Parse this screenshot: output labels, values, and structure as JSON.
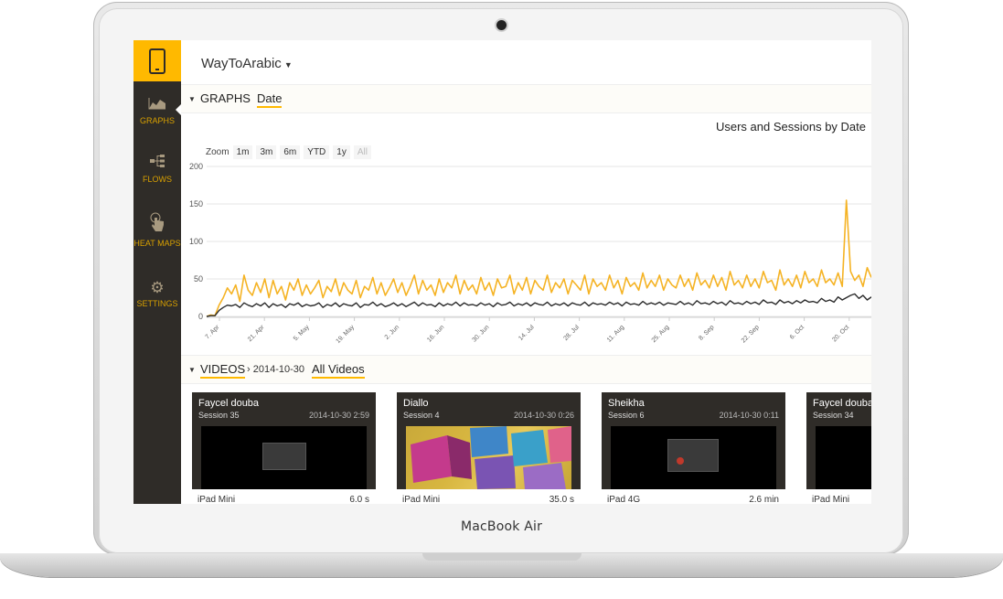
{
  "device": {
    "brand": "MacBook Air"
  },
  "app": {
    "title": "WayToArabic"
  },
  "sidebar": {
    "items": [
      {
        "label": "GRAPHS",
        "icon": "area-chart-icon"
      },
      {
        "label": "FLOWS",
        "icon": "flow-icon"
      },
      {
        "label": "HEAT MAPS",
        "icon": "touch-icon"
      },
      {
        "label": "SETTINGS",
        "icon": "gear-icon"
      }
    ]
  },
  "graphs": {
    "section_label": "GRAPHS",
    "tab_label": "Date",
    "chart_title": "Users and Sessions by Date",
    "zoom": {
      "label": "Zoom",
      "buttons": [
        "1m",
        "3m",
        "6m",
        "YTD",
        "1y",
        "All"
      ]
    }
  },
  "videos": {
    "section_label": "VIDEOS",
    "breadcrumb": "› 2014-10-30",
    "tab_label": "All Videos",
    "cards": [
      {
        "name": "Faycel douba",
        "session": "Session 35",
        "time": "2014-10-30 2:59",
        "device": "iPad Mini",
        "duration": "6.0 s"
      },
      {
        "name": "Diallo",
        "session": "Session 4",
        "time": "2014-10-30 0:26",
        "device": "iPad Mini",
        "duration": "35.0 s"
      },
      {
        "name": "Sheikha",
        "session": "Session 6",
        "time": "2014-10-30 0:11",
        "device": "iPad 4G",
        "duration": "2.6 min"
      },
      {
        "name": "Faycel douba",
        "session": "Session 34",
        "time": "",
        "device": "iPad Mini",
        "duration": ""
      }
    ]
  },
  "colors": {
    "accent": "#ffb900",
    "sidebar": "#2f2c28",
    "series_sessions": "#f5b324",
    "series_users": "#2b2b2b"
  },
  "chart_data": {
    "type": "line",
    "title": "Users and Sessions by Date",
    "xlabel": "",
    "ylabel": "",
    "ylim": [
      0,
      200
    ],
    "y_ticks": [
      0,
      50,
      100,
      150,
      200
    ],
    "x_tick_labels": [
      "7. Apr",
      "21. Apr",
      "5. May",
      "19. May",
      "2. Jun",
      "16. Jun",
      "30. Jun",
      "14. Jul",
      "28. Jul",
      "11. Aug",
      "25. Aug",
      "8. Sep",
      "22. Sep",
      "6. Oct",
      "20. Oct"
    ],
    "series": [
      {
        "values": [
          0,
          2,
          1,
          15,
          25,
          38,
          30,
          42,
          20,
          55,
          35,
          28,
          45,
          32,
          50,
          25,
          48,
          30,
          40,
          22,
          45,
          35,
          50,
          28,
          42,
          30,
          38,
          48,
          25,
          40,
          33,
          50,
          28,
          45,
          35,
          30,
          48,
          25,
          40,
          35,
          52,
          30,
          45,
          28,
          38,
          50,
          32,
          45,
          28,
          40,
          55,
          30,
          48,
          35,
          42,
          28,
          50,
          32,
          45,
          38,
          55,
          30,
          48,
          35,
          42,
          30,
          52,
          35,
          45,
          28,
          50,
          38,
          40,
          55,
          30,
          45,
          35,
          52,
          30,
          48,
          40,
          35,
          55,
          32,
          45,
          38,
          50,
          30,
          48,
          42,
          35,
          55,
          30,
          50,
          40,
          45,
          35,
          55,
          38,
          48,
          30,
          52,
          40,
          45,
          35,
          58,
          38,
          48,
          40,
          55,
          35,
          50,
          42,
          38,
          55,
          40,
          50,
          35,
          58,
          42,
          48,
          38,
          55,
          40,
          52,
          35,
          60,
          42,
          48,
          38,
          55,
          40,
          50,
          38,
          60,
          45,
          48,
          35,
          62,
          42,
          50,
          40,
          55,
          38,
          60,
          45,
          50,
          40,
          62,
          45,
          50,
          42,
          58,
          40,
          155,
          60,
          48,
          55,
          40,
          65,
          52
        ]
      },
      {
        "values": [
          0,
          1,
          1,
          8,
          12,
          15,
          14,
          16,
          12,
          18,
          15,
          13,
          17,
          14,
          18,
          12,
          17,
          14,
          16,
          12,
          17,
          15,
          18,
          13,
          16,
          14,
          15,
          18,
          12,
          16,
          14,
          18,
          13,
          17,
          15,
          14,
          18,
          12,
          16,
          15,
          19,
          14,
          17,
          13,
          15,
          18,
          14,
          17,
          13,
          16,
          19,
          14,
          18,
          15,
          16,
          13,
          18,
          14,
          17,
          15,
          19,
          14,
          18,
          15,
          16,
          14,
          18,
          15,
          17,
          13,
          18,
          15,
          16,
          19,
          14,
          17,
          15,
          18,
          14,
          18,
          16,
          15,
          19,
          14,
          17,
          15,
          18,
          14,
          18,
          16,
          15,
          19,
          14,
          18,
          16,
          17,
          15,
          19,
          16,
          18,
          14,
          19,
          16,
          17,
          15,
          20,
          16,
          18,
          16,
          19,
          15,
          18,
          17,
          16,
          20,
          16,
          18,
          15,
          21,
          17,
          18,
          16,
          20,
          17,
          19,
          15,
          21,
          17,
          18,
          16,
          20,
          17,
          19,
          16,
          22,
          18,
          19,
          16,
          22,
          18,
          20,
          17,
          21,
          18,
          22,
          19,
          20,
          18,
          24,
          20,
          22,
          19,
          26,
          22,
          25,
          28,
          30,
          24,
          28,
          22,
          26
        ]
      }
    ]
  }
}
